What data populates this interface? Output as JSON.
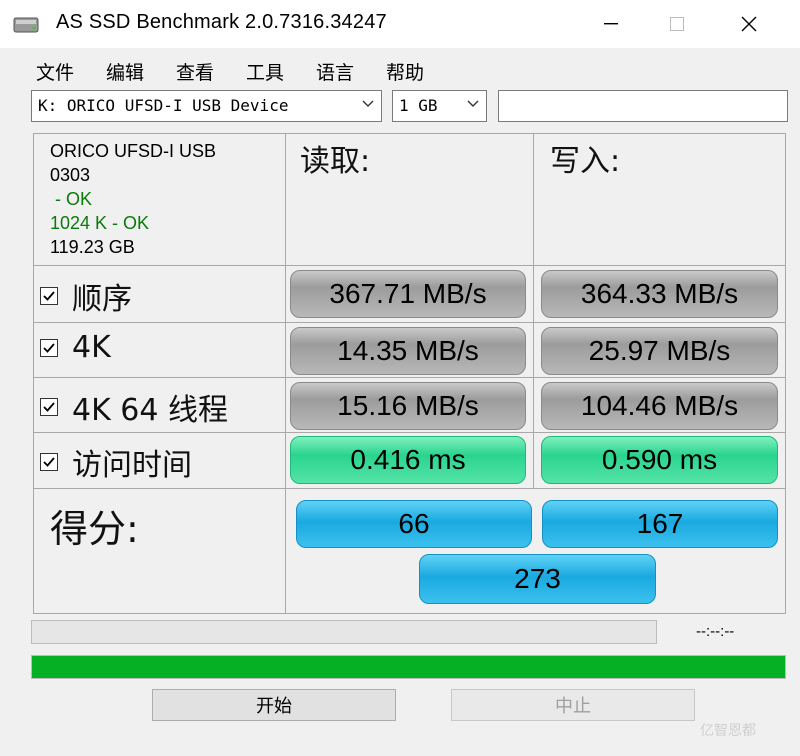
{
  "window": {
    "title": "AS SSD Benchmark 2.0.7316.34247"
  },
  "menu": [
    "文件",
    "编辑",
    "查看",
    "工具",
    "语言",
    "帮助"
  ],
  "drive_select": {
    "value": "K: ORICO UFSD-I USB Device"
  },
  "size_select": {
    "value": "1 GB"
  },
  "device_info": {
    "name": "ORICO UFSD-I USB",
    "firmware": "0303",
    "status1": " - OK",
    "status2": "1024 K - OK",
    "capacity": "119.23 GB"
  },
  "columns": {
    "read": "读取:",
    "write": "写入:"
  },
  "rows": [
    {
      "label": "顺序",
      "read": "367.71 MB/s",
      "write": "364.33 MB/s",
      "checked": true
    },
    {
      "label": "4K",
      "read": "14.35 MB/s",
      "write": "25.97 MB/s",
      "checked": true
    },
    {
      "label": "4K 64 线程",
      "read": "15.16 MB/s",
      "write": "104.46 MB/s",
      "checked": true
    },
    {
      "label": "访问时间",
      "read": "0.416 ms",
      "write": "0.590 ms",
      "checked": true
    }
  ],
  "score": {
    "label": "得分:",
    "read": "66",
    "write": "167",
    "total": "273"
  },
  "progress": {
    "timer": "--:--:--",
    "completion": 1.0
  },
  "buttons": {
    "start": "开始",
    "stop": "中止"
  },
  "watermark": "亿智恩都",
  "colors": {
    "progress": "#06b025",
    "ok_text": "#0a7a0a",
    "time_cell": "#2ad48e",
    "score_cell": "#1aa9e0"
  }
}
